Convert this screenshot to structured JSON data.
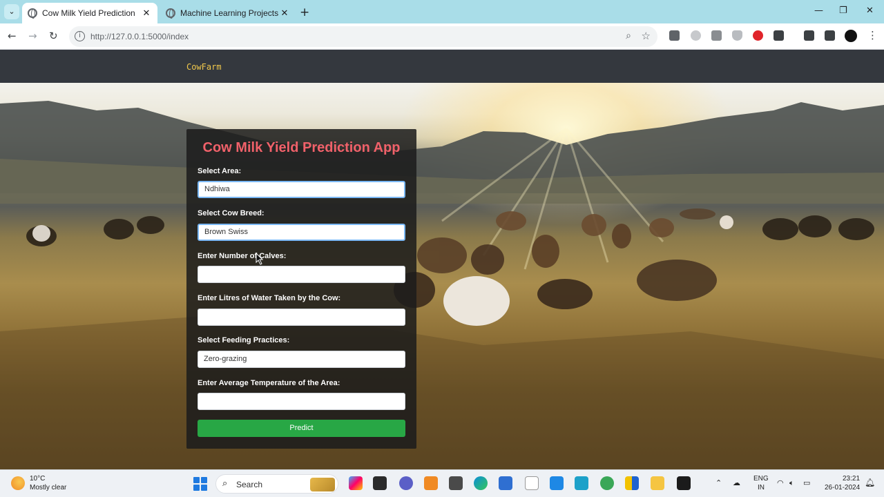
{
  "browser": {
    "tabs": [
      {
        "title": "Cow Milk Yield Prediction",
        "active": true
      },
      {
        "title": "Machine Learning Projects",
        "active": false
      }
    ],
    "url": "http://127.0.0.1:5000/index",
    "icons": {
      "tab_list": "chevron-down-icon",
      "close": "close-icon",
      "new_tab": "plus-icon",
      "back": "arrow-left-icon",
      "forward": "arrow-right-icon",
      "reload": "reload-icon",
      "site_info": "info-icon",
      "zoom": "magnifier-icon",
      "bookmark": "star-icon",
      "minimize": "minimize-icon",
      "maximize": "maximize-icon",
      "close_window": "close-icon"
    }
  },
  "app": {
    "brand": "CowFarm",
    "form": {
      "title": "Cow Milk Yield Prediction App",
      "fields": [
        {
          "label": "Select Area:",
          "value": "Ndhiwa"
        },
        {
          "label": "Select Cow Breed:",
          "value": "Brown Swiss"
        },
        {
          "label": "Enter Number of Calves:",
          "value": ""
        },
        {
          "label": "Enter Litres of Water Taken by the Cow:",
          "value": ""
        },
        {
          "label": "Select Feeding Practices:",
          "value": "Zero-grazing"
        },
        {
          "label": "Enter Average Temperature of the Area:",
          "value": ""
        }
      ],
      "submit_label": "Predict"
    },
    "colors": {
      "title": "#f0616a",
      "brand": "#f2c94c",
      "button": "#28a745",
      "navbar": "#34383e"
    }
  },
  "taskbar": {
    "weather": {
      "temp": "10°C",
      "condition": "Mostly clear"
    },
    "search_placeholder": "Search",
    "language": {
      "line1": "ENG",
      "line2": "IN"
    },
    "time": "23:21",
    "date": "26-01-2024"
  }
}
